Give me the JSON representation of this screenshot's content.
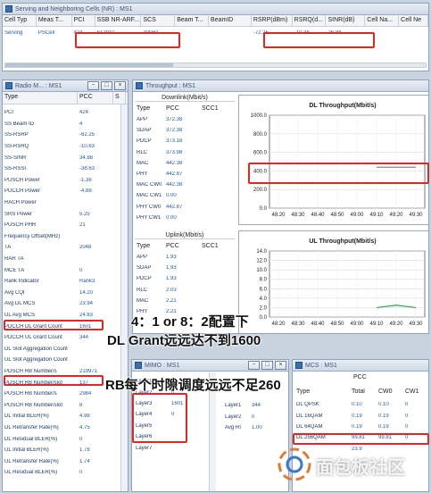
{
  "cells": {
    "title": "Serving and Neighboring Cells (NR) : MS1",
    "headers": [
      "Cell Typ",
      "Meas T...",
      "PCI",
      "SSB NR-ARF...",
      "SCS",
      "Beam T...",
      "BeamID",
      "RSRP(dBm)",
      "RSRQ(d...",
      "SINR(dB)",
      "Cell Na...",
      "Cell Ne"
    ],
    "row": [
      "Serving",
      "PSCell",
      "424",
      "512910",
      "30kHz",
      "",
      "",
      "-72.25",
      "-10.38",
      "26.88",
      "",
      ""
    ]
  },
  "radio": {
    "title": "Radio M... : MS1",
    "headers": [
      "Type",
      "PCC",
      "S"
    ],
    "rows": [
      [
        "PCI",
        "424"
      ],
      [
        "SS Beam ID",
        "4"
      ],
      [
        "SS-RSRP",
        "-62.25"
      ],
      [
        "SS-RSRQ",
        "-10.63"
      ],
      [
        "SS-SINR",
        "34.88"
      ],
      [
        "SS-RSSI",
        "-38.63"
      ],
      [
        "PUSCH Power",
        "-1.38"
      ],
      [
        "PUCCH Power",
        "-4.88"
      ],
      [
        "RACH Power",
        ""
      ],
      [
        "SRS Power",
        "5.25"
      ],
      [
        "PUSCH PHR",
        "21"
      ],
      [
        "Frequency Offset(MHz)",
        ""
      ],
      [
        "TA",
        "2048"
      ],
      [
        "RAR TA",
        ""
      ],
      [
        "MCE TA",
        "0"
      ],
      [
        "Rank Indicator",
        "Rank3"
      ],
      [
        "Avg CQI",
        "14.20"
      ],
      [
        "Avg DL MCS",
        "23.94"
      ],
      [
        "UL Avg MCS",
        "24.83"
      ],
      [
        "PDCCH DL Grant Count",
        "1601"
      ],
      [
        "PDCCH UL Grant Count",
        "344"
      ],
      [
        "DL Slot Aggregation Count",
        ""
      ],
      [
        "UL Slot Aggregation Count",
        ""
      ],
      [
        "PDSCH RB Number/s",
        "219971"
      ],
      [
        "PDSCH RB Number/slot",
        "137"
      ],
      [
        "PUSCH RB Number/s",
        "2984"
      ],
      [
        "PUSCH RB Number/slot",
        "8"
      ],
      [
        "DL Initial BLER(%)",
        "4.98"
      ],
      [
        "DL Retransfer Rate(%)",
        "4.75"
      ],
      [
        "DL Residual BLER(%)",
        "0"
      ],
      [
        "UL Initial BLER(%)",
        "1.78"
      ],
      [
        "UL Retransfer Rate(%)",
        "1.74"
      ],
      [
        "UL Residual BLER(%)",
        "0"
      ]
    ]
  },
  "tput": {
    "title": "Throughput : MS1",
    "dl_header": "Downlink(Mbit/s)",
    "ul_header": "Uplink(Mbit/s)",
    "col_type": "Type",
    "col_pcc": "PCC",
    "col_scc": "SCC1",
    "dl_rows": [
      [
        "APP",
        "372.38"
      ],
      [
        "SDAP",
        "372.38"
      ],
      [
        "PDCP",
        "373.18"
      ],
      [
        "RLC",
        "373.98"
      ],
      [
        "MAC",
        "442.38"
      ],
      [
        "PHY",
        "442.87"
      ],
      [
        "MAC CW0",
        "442.38"
      ],
      [
        "MAC CW1",
        "0.00"
      ],
      [
        "PHY CW0",
        "442.87"
      ],
      [
        "PHY CW1",
        "0.00"
      ]
    ],
    "ul_rows": [
      [
        "APP",
        "1.93"
      ],
      [
        "SDAP",
        "1.93"
      ],
      [
        "PDCP",
        "1.93"
      ],
      [
        "RLC",
        "2.03"
      ],
      [
        "MAC",
        "2.21"
      ],
      [
        "PHY",
        "2.21"
      ]
    ]
  },
  "chart_data": [
    {
      "type": "line",
      "title": "DL Throughput(Mbit/s)",
      "ylim": [
        0,
        1000
      ],
      "yticks": [
        "1000.0",
        "800.0",
        "600.0",
        "400.0",
        "200.0",
        "0.0"
      ],
      "x": [
        "48:20",
        "48:30",
        "48:40",
        "48:50",
        "49:00",
        "49:10",
        "49:20",
        "49:30"
      ],
      "series": [
        {
          "values": [
            null,
            null,
            null,
            null,
            null,
            440,
            440,
            440
          ]
        }
      ]
    },
    {
      "type": "line",
      "title": "UL Throughput(Mbit/s)",
      "ylim": [
        0,
        14
      ],
      "yticks": [
        "14.0",
        "12.0",
        "10.0",
        "8.0",
        "6.0",
        "4.0",
        "2.0",
        "0.0"
      ],
      "x": [
        "48:20",
        "48:30",
        "48:40",
        "48:50",
        "49:00",
        "49:10",
        "49:20",
        "49:30"
      ],
      "series": [
        {
          "values": [
            null,
            null,
            null,
            null,
            null,
            2,
            2.5,
            2
          ]
        }
      ]
    }
  ],
  "mimo": {
    "title": "MIMO : MS1",
    "rows": [
      [
        "Layer1",
        "0"
      ],
      [
        "Layer2",
        "0"
      ],
      [
        "Layer3",
        "1601"
      ],
      [
        "Layer4",
        "0"
      ],
      [
        "Layer5",
        ""
      ],
      [
        "Layer6",
        ""
      ],
      [
        "Layer7",
        ""
      ]
    ],
    "rows2": [
      [
        "Layer1",
        "344"
      ],
      [
        "Layer2",
        "0"
      ],
      [
        "Avg RI",
        "1.00"
      ]
    ]
  },
  "mcs": {
    "title": "MCS : MS1",
    "group": "PCC",
    "headers": [
      "Type",
      "Total",
      "CW0",
      "CW1"
    ],
    "rows": [
      [
        "DL QPSK",
        "0.10",
        "0.10",
        "0"
      ],
      [
        "DL 16QAM",
        "0.19",
        "0.19",
        "0"
      ],
      [
        "DL 64QAM",
        "0.19",
        "0.19",
        "0"
      ],
      [
        "DL 256QAM",
        "99.81",
        "99.81",
        "0"
      ],
      [
        "",
        "23.9",
        "",
        ""
      ]
    ]
  },
  "annotations": {
    "line1": "4：1 or 8：2配置下",
    "line2": "DL Grant远远达不到1600",
    "line3": "RB每个时隙调度远远不足260"
  },
  "watermark": "面包板社区"
}
